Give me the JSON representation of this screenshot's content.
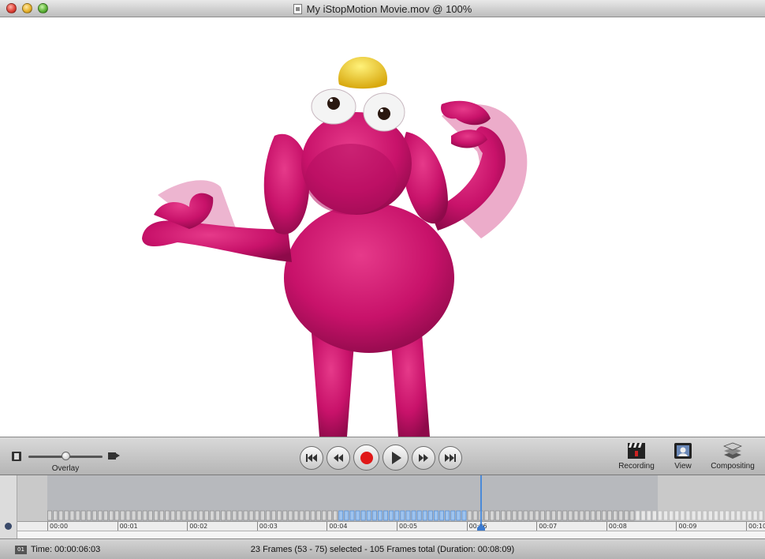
{
  "window": {
    "title": "My iStopMotion Movie.mov @ 100%"
  },
  "canvas": {
    "subject": "pink clay figure",
    "colors": {
      "clay": "#d4146f",
      "hair": "#f4d21e",
      "background": "#ffffff"
    }
  },
  "controls": {
    "overlay_label": "Overlay",
    "overlay_fraction": 0.5,
    "transport": [
      {
        "name": "skip-to-start",
        "icon": "skip-back-icon"
      },
      {
        "name": "step-back",
        "icon": "rewind-icon"
      },
      {
        "name": "record",
        "icon": "record-icon"
      },
      {
        "name": "play",
        "icon": "play-icon"
      },
      {
        "name": "step-forward",
        "icon": "fast-forward-icon"
      },
      {
        "name": "skip-to-end",
        "icon": "skip-forward-icon"
      }
    ],
    "tools": {
      "recording_label": "Recording",
      "view_label": "View",
      "compositing_label": "Compositing"
    }
  },
  "timeline": {
    "ticks": [
      "00:00",
      "00:01",
      "00:02",
      "00:03",
      "00:04",
      "00:05",
      "00:06",
      "00:07",
      "00:08",
      "00:09",
      "00:10"
    ],
    "selection_start_frame": 53,
    "selection_end_frame": 75,
    "total_frames": 105,
    "accent_color": "#4b8ad8"
  },
  "status": {
    "time_icon_text": "01",
    "time": "Time: 00:00:06:03",
    "info": "23 Frames (53 - 75) selected - 105 Frames total (Duration: 00:08:09)"
  }
}
